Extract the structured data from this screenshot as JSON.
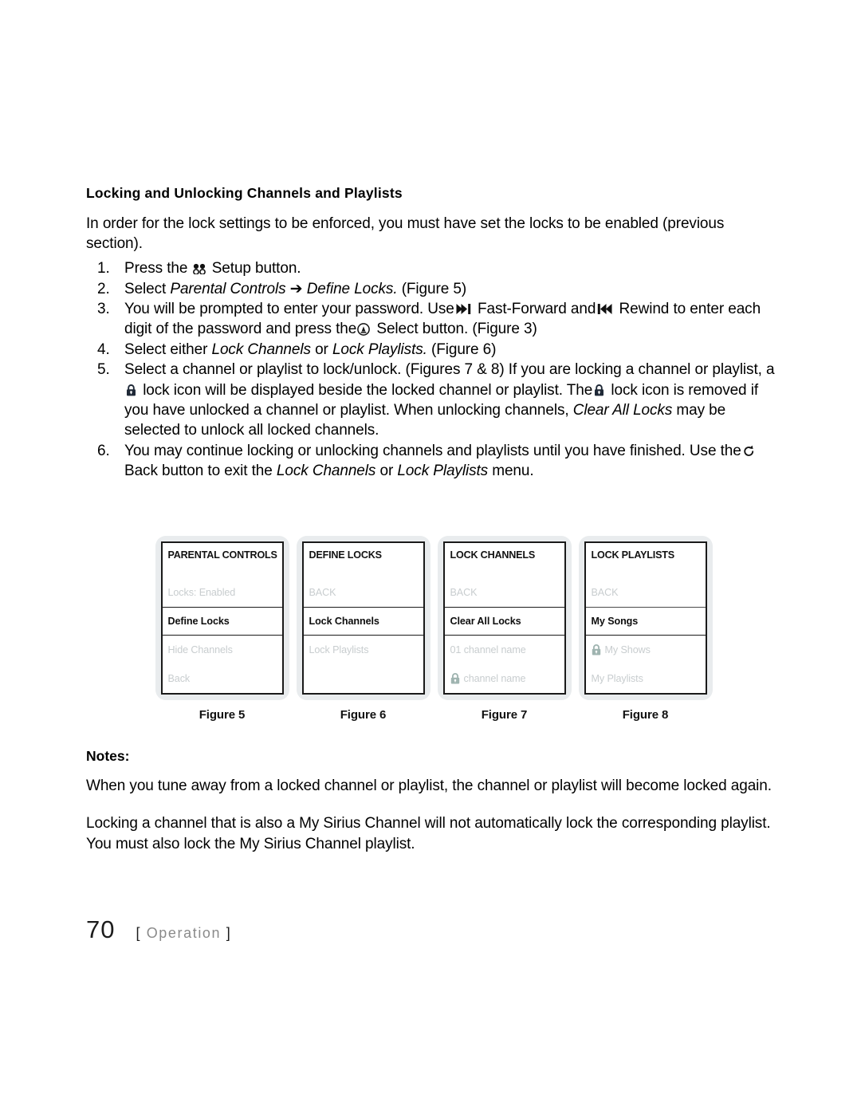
{
  "document": {
    "section_heading": "Locking and Unlocking Channels and Playlists",
    "intro": "In order for the lock settings to be enforced, you must have set the locks to be enabled (previous section).",
    "steps": [
      {
        "num": "1.",
        "parts": [
          {
            "t": "text",
            "v": "Press the "
          },
          {
            "t": "icon",
            "v": "setup-icon"
          },
          {
            "t": "text",
            "v": " Setup button."
          }
        ],
        "plain": "Press the [setup] Setup button."
      },
      {
        "num": "2.",
        "parts": [
          {
            "t": "text",
            "v": "Select "
          },
          {
            "t": "italic",
            "v": "Parental Controls"
          },
          {
            "t": "text",
            "v": " ➔ "
          },
          {
            "t": "italic",
            "v": "Define Locks."
          },
          {
            "t": "text",
            "v": " (Figure 5)"
          }
        ],
        "plain": "Select Parental Controls ➔ Define Locks. (Figure 5)"
      },
      {
        "num": "3.",
        "plain": "You will be prompted to enter your password. Use [ff] Fast-Forward and [rew] Rewind to enter each digit of the password and press the [select] Select button. (Figure 3)"
      },
      {
        "num": "4.",
        "plain": "Select either Lock Channels or Lock Playlists. (Figure 6)"
      },
      {
        "num": "5.",
        "plain": "Select a channel or playlist to lock/unlock. (Figures 7 & 8) If you are locking a channel or playlist, a [lock] lock icon will be displayed beside the locked channel or playlist. The [lock] lock icon is removed if you have unlocked a channel or playlist. When unlocking channels, Clear All Locks may be selected to unlock all locked channels."
      },
      {
        "num": "6.",
        "plain": "You may continue locking or unlocking channels and playlists until you have finished. Use the [back] Back button to exit the Lock Channels or Lock Playlists menu."
      }
    ],
    "step3": {
      "a": "You will be prompted to enter your password. Use",
      "b": "Fast-Forward and",
      "c": "Rewind to enter each digit of the password and press the",
      "d": "Select button. (Figure 3)"
    },
    "step4": {
      "a": "Select either ",
      "i1": "Lock Channels",
      "b": " or ",
      "i2": "Lock Playlists.",
      "c": " (Figure 6)"
    },
    "step5": {
      "a": "Select a channel or playlist to lock/unlock. (Figures 7 & 8) If you are locking a channel or playlist, a",
      "b": "lock icon will be displayed beside the locked channel or playlist. The",
      "c": "lock icon is removed if you have unlocked a channel or playlist. When unlocking channels,",
      "i1": "Clear All Locks",
      "d": " may be selected to unlock all locked channels."
    },
    "step6": {
      "a": "You may continue locking or unlocking channels and playlists until you have finished. Use the",
      "b": "Back button to exit the",
      "i1": "Lock Channels",
      "c": " or ",
      "i2": "Lock Playlists",
      "d": " menu."
    },
    "notes": {
      "heading": "Notes:",
      "paragraphs": [
        "When you tune away from a locked channel or playlist, the channel or playlist will become locked again.",
        "Locking a channel that is also a My Sirius Channel will not automatically lock the corresponding playlist. You must also lock the My Sirius Channel playlist."
      ]
    },
    "footer": {
      "page_number": "70",
      "bracket_open": "[",
      "section": "Operation",
      "bracket_close": "]"
    }
  },
  "figures": [
    {
      "caption": "Figure 5",
      "title": "PARENTAL CONTROLS",
      "rows": [
        {
          "label": "Locks: Enabled",
          "state": "dim",
          "lock": false
        },
        {
          "label": "Define Locks",
          "state": "selected",
          "lock": false
        },
        {
          "label": "Hide Channels",
          "state": "dim",
          "lock": false
        },
        {
          "label": "Back",
          "state": "dim",
          "lock": false
        }
      ]
    },
    {
      "caption": "Figure 6",
      "title": "DEFINE LOCKS",
      "rows": [
        {
          "label": "BACK",
          "state": "dim",
          "lock": false
        },
        {
          "label": "Lock Channels",
          "state": "selected",
          "lock": false
        },
        {
          "label": "Lock Playlists",
          "state": "dim",
          "lock": false
        }
      ]
    },
    {
      "caption": "Figure 7",
      "title": "LOCK CHANNELS",
      "rows": [
        {
          "label": "BACK",
          "state": "dim",
          "lock": false
        },
        {
          "label": "Clear All Locks",
          "state": "selected",
          "lock": false
        },
        {
          "label": "01 channel name",
          "state": "dim",
          "lock": false
        },
        {
          "label": "channel name",
          "state": "dim",
          "lock": true
        }
      ]
    },
    {
      "caption": "Figure 8",
      "title": "LOCK PLAYLISTS",
      "rows": [
        {
          "label": "BACK",
          "state": "dim",
          "lock": false
        },
        {
          "label": "My Songs",
          "state": "selected",
          "lock": false
        },
        {
          "label": "My Shows",
          "state": "dim",
          "lock": true
        },
        {
          "label": "My Playlists",
          "state": "dim",
          "lock": false
        }
      ]
    }
  ],
  "colors": {
    "text": "#000000",
    "dim_text": "#c8cdcf",
    "bezel": "#e9ecee",
    "screen_border": "#1a1a1a",
    "lock_icon": "#9fb4b0",
    "folio_section": "#8a8a8a"
  },
  "icons": {
    "setup": "setup-icon",
    "fast_forward": "fast-forward-icon",
    "rewind": "rewind-icon",
    "select": "select-icon",
    "back": "back-icon",
    "lock": "lock-icon",
    "arrow": "➔"
  }
}
